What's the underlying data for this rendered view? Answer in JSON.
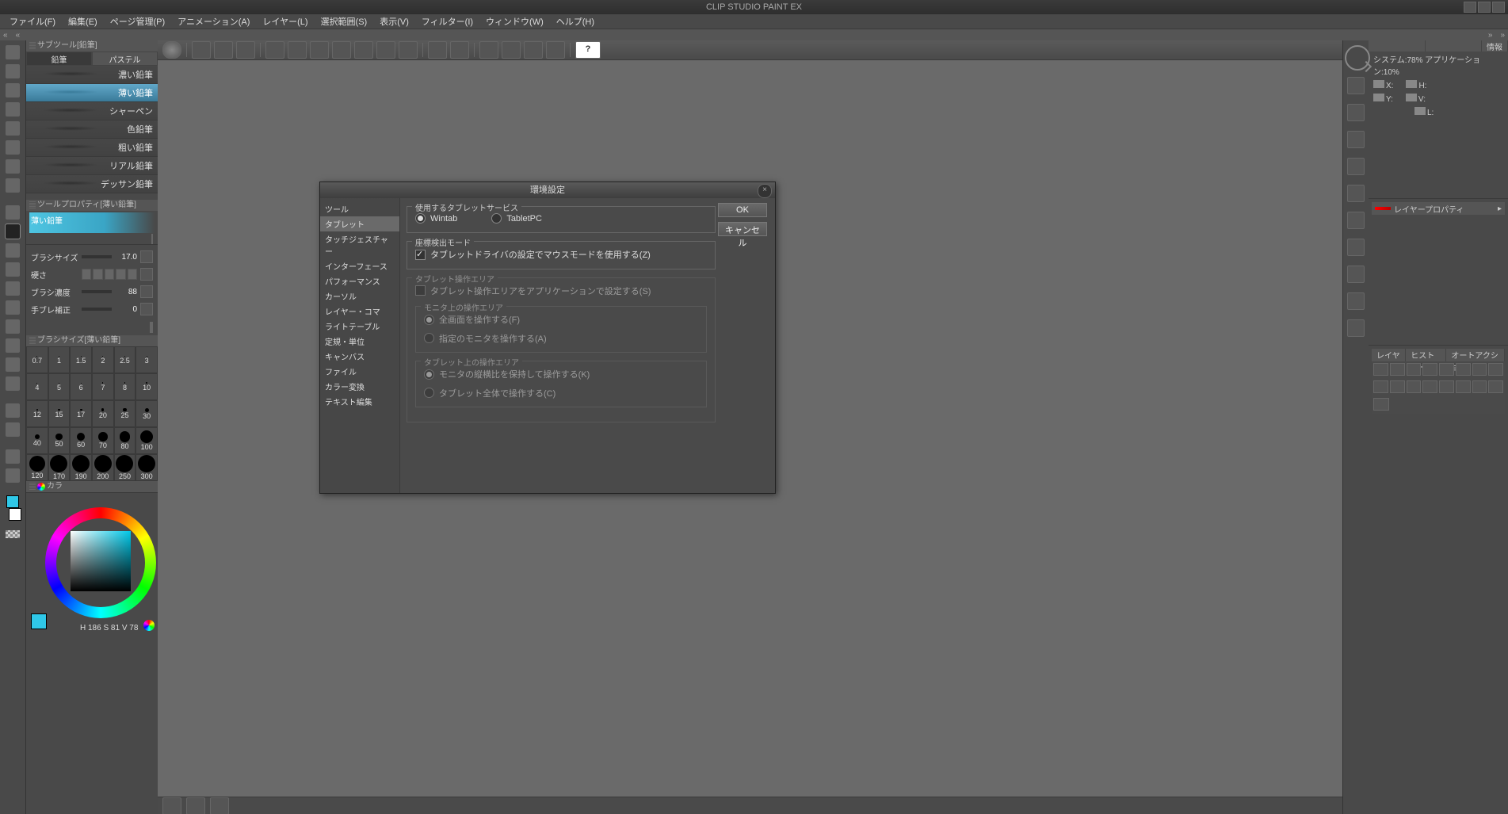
{
  "app_title": "CLIP STUDIO PAINT EX",
  "menu": [
    "ファイル(F)",
    "編集(E)",
    "ページ管理(P)",
    "アニメーション(A)",
    "レイヤー(L)",
    "選択範囲(S)",
    "表示(V)",
    "フィルター(I)",
    "ウィンドウ(W)",
    "ヘルプ(H)"
  ],
  "subtool": {
    "title": "サブツール[鉛筆]",
    "tabs": [
      "鉛筆",
      "パステル"
    ],
    "items": [
      "濃い鉛筆",
      "薄い鉛筆",
      "シャーペン",
      "色鉛筆",
      "粗い鉛筆",
      "リアル鉛筆",
      "デッサン鉛筆"
    ],
    "selected": 1
  },
  "toolprop": {
    "title": "ツールプロパティ[薄い鉛筆]",
    "brush_name": "薄い鉛筆",
    "rows": {
      "size_label": "ブラシサイズ",
      "size_val": "17.0",
      "hard_label": "硬さ",
      "dens_label": "ブラシ濃度",
      "dens_val": "88",
      "stab_label": "手ブレ補正",
      "stab_val": "0"
    }
  },
  "brushsize": {
    "title": "ブラシサイズ[薄い鉛筆]",
    "sizes": [
      "0.7",
      "1",
      "1.5",
      "2",
      "2.5",
      "3",
      "4",
      "5",
      "6",
      "7",
      "8",
      "10",
      "12",
      "15",
      "17",
      "20",
      "25",
      "30",
      "40",
      "50",
      "60",
      "70",
      "80",
      "100",
      "120",
      "170",
      "190",
      "200",
      "250",
      "300"
    ]
  },
  "color": {
    "tab": "カラ",
    "readout": "H 186 S 81 V 78"
  },
  "info": {
    "tab": "情報",
    "sys": "システム:78%  アプリケーション:10%",
    "coords": {
      "x": "X:",
      "y": "Y:",
      "h": "H:",
      "v": "V:",
      "l": "L:"
    }
  },
  "layerprop": {
    "title": "レイヤープロパティ"
  },
  "layer": {
    "tabs": [
      "レイヤー",
      "ヒストリー",
      "オートアクション"
    ]
  },
  "dialog": {
    "title": "環境設定",
    "ok": "OK",
    "cancel": "キャンセル",
    "categories": [
      "ツール",
      "タブレット",
      "タッチジェスチャー",
      "インターフェース",
      "パフォーマンス",
      "カーソル",
      "レイヤー・コマ",
      "ライトテーブル",
      "定規・単位",
      "キャンバス",
      "ファイル",
      "カラー変換",
      "テキスト編集"
    ],
    "cat_selected": 1,
    "grp_tablet_service": "使用するタブレットサービス",
    "radio_wintab": "Wintab",
    "radio_tabletpc": "TabletPC",
    "grp_coord": "座標検出モード",
    "chk_mouse": "タブレットドライバの設定でマウスモードを使用する(Z)",
    "grp_area": "タブレット操作エリア",
    "chk_app": "タブレット操作エリアをアプリケーションで設定する(S)",
    "grp_monitor": "モニタ上の操作エリア",
    "r_fullscreen": "全画面を操作する(F)",
    "r_monitor": "指定のモニタを操作する(A)",
    "grp_tab_area": "タブレット上の操作エリア",
    "r_aspect": "モニタの縦横比を保持して操作する(K)",
    "r_whole": "タブレット全体で操作する(C)"
  }
}
